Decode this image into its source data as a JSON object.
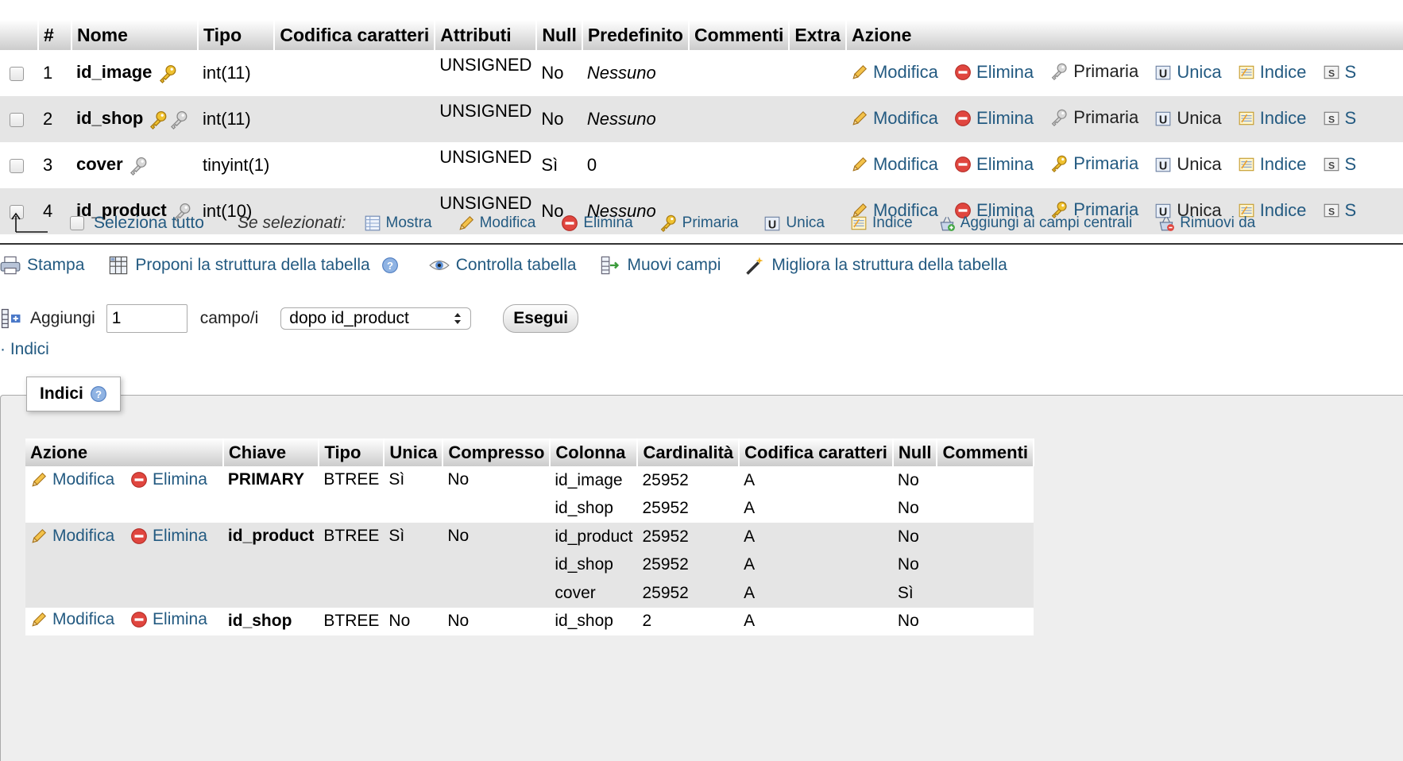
{
  "structure": {
    "headers": [
      "#",
      "Nome",
      "Tipo",
      "Codifica caratteri",
      "Attributi",
      "Null",
      "Predefinito",
      "Commenti",
      "Extra",
      "Azione"
    ],
    "rows": [
      {
        "num": "1",
        "name": "id_image",
        "type": "int(11)",
        "attr": "UNSIGNED",
        "null": "No",
        "default": "Nessuno"
      },
      {
        "num": "2",
        "name": "id_shop",
        "type": "int(11)",
        "attr": "UNSIGNED",
        "null": "No",
        "default": "Nessuno"
      },
      {
        "num": "3",
        "name": "cover",
        "type": "tinyint(1)",
        "attr": "UNSIGNED",
        "null": "Sì",
        "default": "0"
      },
      {
        "num": "4",
        "name": "id_product",
        "type": "int(10)",
        "attr": "UNSIGNED",
        "null": "No",
        "default": "Nessuno"
      }
    ],
    "actions": {
      "edit": "Modifica",
      "drop": "Elimina",
      "primary": "Primaria",
      "unique": "Unica",
      "index": "Indice",
      "more": "S"
    }
  },
  "selection_bar": {
    "select_all": "Seleziona tutto",
    "with_selected": "Se selezionati:",
    "browse": "Mostra",
    "edit": "Modifica",
    "drop": "Elimina",
    "primary": "Primaria",
    "unique": "Unica",
    "index": "Indice",
    "add_central": "Aggiungi ai campi centrali",
    "remove_central": "Rimuovi da"
  },
  "operations": {
    "print": "Stampa",
    "propose": "Proponi la struttura della tabella",
    "check": "Controlla tabella",
    "move": "Muovi campi",
    "improve": "Migliora la struttura della tabella"
  },
  "add_fields": {
    "label": "Aggiungi",
    "count": "1",
    "unit": "campo/i",
    "position": "dopo id_product",
    "go": "Esegui"
  },
  "indexes_link": "Indici",
  "indexes": {
    "legend": "Indici",
    "headers": [
      "Azione",
      "Chiave",
      "Tipo",
      "Unica",
      "Compresso",
      "Colonna",
      "Cardinalità",
      "Codifica caratteri",
      "Null",
      "Commenti"
    ],
    "edit": "Modifica",
    "drop": "Elimina",
    "groups": [
      {
        "key": "PRIMARY",
        "type": "BTREE",
        "unique": "Sì",
        "packed": "No",
        "cols": [
          {
            "col": "id_image",
            "card": "25952",
            "coll": "A",
            "null": "No"
          },
          {
            "col": "id_shop",
            "card": "25952",
            "coll": "A",
            "null": "No"
          }
        ]
      },
      {
        "key": "id_product",
        "type": "BTREE",
        "unique": "Sì",
        "packed": "No",
        "cols": [
          {
            "col": "id_product",
            "card": "25952",
            "coll": "A",
            "null": "No"
          },
          {
            "col": "id_shop",
            "card": "25952",
            "coll": "A",
            "null": "No"
          },
          {
            "col": "cover",
            "card": "25952",
            "coll": "A",
            "null": "Sì"
          }
        ]
      },
      {
        "key": "id_shop",
        "type": "BTREE",
        "unique": "No",
        "packed": "No",
        "cols": [
          {
            "col": "id_shop",
            "card": "2",
            "coll": "A",
            "null": "No"
          }
        ]
      }
    ]
  },
  "colors": {
    "link": "#235a81",
    "row_alt": "#e5e5e5",
    "fieldset_bg": "#eeeeee"
  }
}
